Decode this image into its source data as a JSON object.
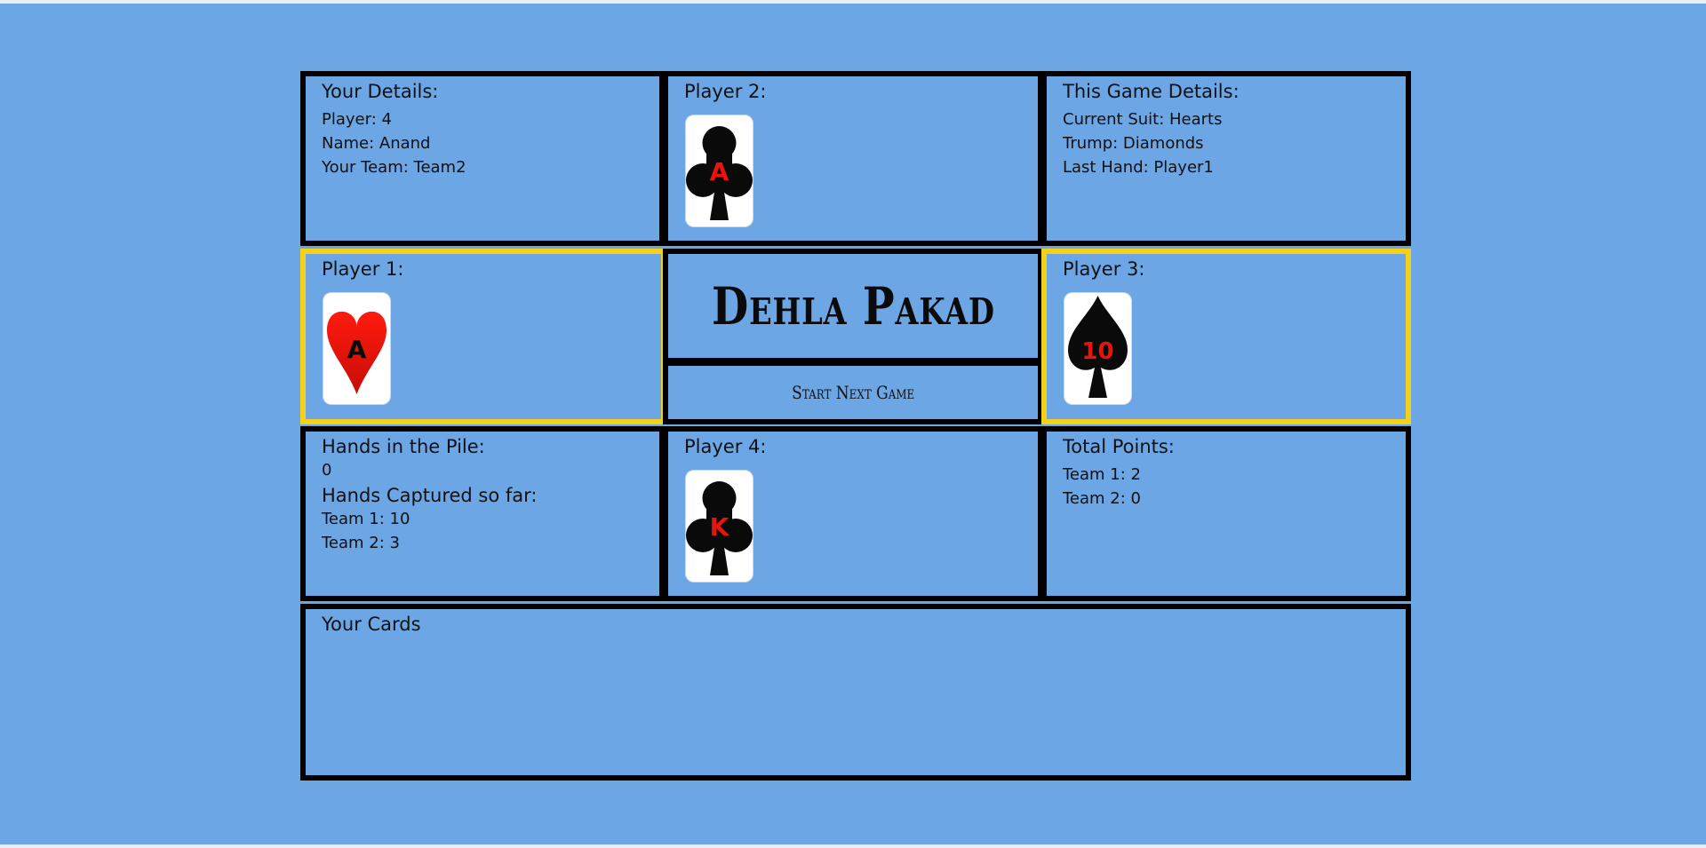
{
  "app": {
    "title": "Dehla Pakad",
    "start_button_label": "Start Next Game"
  },
  "your_details": {
    "heading": "Your Details:",
    "player": "Player: 4",
    "name": "Name: Anand",
    "team": "Your Team: Team2"
  },
  "game_details": {
    "heading": "This Game Details:",
    "current_suit": "Current Suit: Hearts",
    "trump": "Trump: Diamonds",
    "last_hand": "Last Hand: Player1"
  },
  "players": {
    "p1": {
      "label": "Player 1:",
      "card": {
        "rank": "A",
        "suit": "heart"
      },
      "highlighted": true
    },
    "p2": {
      "label": "Player 2:",
      "card": {
        "rank": "A",
        "suit": "club"
      },
      "highlighted": false
    },
    "p3": {
      "label": "Player 3:",
      "card": {
        "rank": "10",
        "suit": "spade"
      },
      "highlighted": true
    },
    "p4": {
      "label": "Player 4:",
      "card": {
        "rank": "K",
        "suit": "club"
      },
      "highlighted": false
    }
  },
  "pile": {
    "heading": "Hands in the Pile:",
    "value": "0",
    "captured_heading": "Hands Captured so far:",
    "team1": "Team 1: 10",
    "team2": "Team 2: 3"
  },
  "points": {
    "heading": "Total Points:",
    "team1": "Team 1: 2",
    "team2": "Team 2: 0"
  },
  "your_cards": {
    "heading": "Your Cards"
  },
  "colors": {
    "background": "#6ca6e4",
    "border": "#000000",
    "highlight": "#f3d11a",
    "red_suit": "#e8140c",
    "black_suit": "#0a0a0a"
  }
}
